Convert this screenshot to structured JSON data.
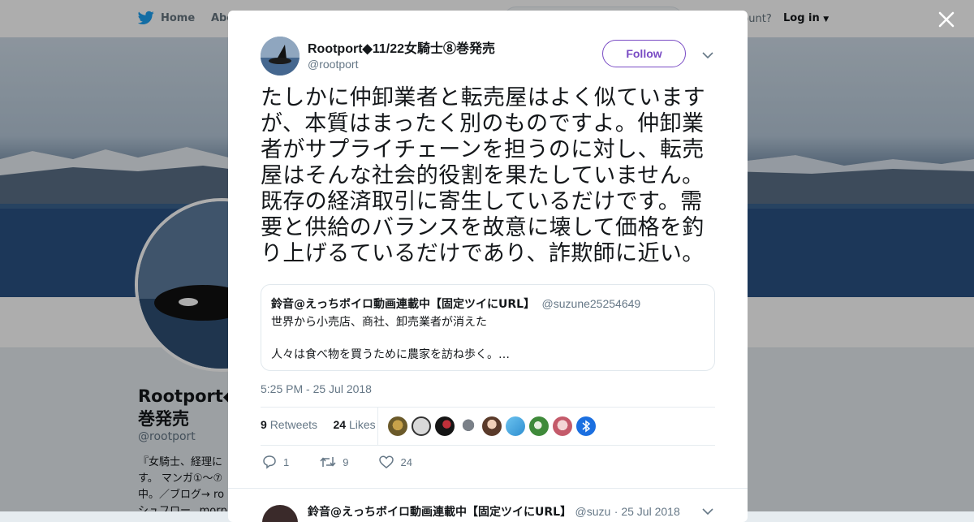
{
  "topbar": {
    "home_label": "Home",
    "about_label": "Abo",
    "account_text": "ccount?",
    "login_label": "Log in"
  },
  "profile": {
    "name": "Rootport◆",
    "name_line2": "巻発売",
    "handle": "@rootport",
    "bio_lines": [
      "『女騎士、経理に",
      "す。 マンガ①～⑦",
      "中。／ブログ→ ro",
      "シュフロー_ morph"
    ]
  },
  "tweet": {
    "author_name": "Rootport◆11/22女騎士⑧巻発売",
    "author_handle": "@rootport",
    "follow_label": "Follow",
    "text": "たしかに仲卸業者と転売屋はよく似ていますが、本質はまったく別のものですよ。仲卸業者がサプライチェーンを担うのに対し、転売屋はそんな社会的役割を果たしていません。既存の経済取引に寄生しているだけです。需要と供給のバランスを故意に壊して価格を釣り上げるているだけであり、詐欺師に近い。",
    "quote": {
      "name": "鈴音@えっちボイロ動画連載中【固定ツイにURL】",
      "handle": "@suzune25254649",
      "line1": "世界から小売店、商社、卸売業者が消えた",
      "line2": "人々は食べ物を買うために農家を訪ね歩く。…"
    },
    "timestamp": "5:25 PM - 25 Jul 2018",
    "retweets_count": "9",
    "retweets_label": "Retweets",
    "likes_count": "24",
    "likes_label": "Likes",
    "likers": [
      "avatar-1",
      "avatar-2",
      "avatar-3",
      "avatar-4",
      "avatar-5",
      "avatar-6",
      "avatar-7",
      "avatar-8",
      "avatar-9"
    ],
    "actions": {
      "reply_count": "1",
      "retweet_count": "9",
      "like_count": "24"
    }
  },
  "reply": {
    "name": "鈴音@えっちボイロ動画連載中【固定ツイにURL】",
    "handle": "@suzu",
    "date": "· 25 Jul 2018"
  },
  "colors": {
    "follow_accent": "#794bc4",
    "twitter_blue": "#1da1f2",
    "text_primary": "#14171a",
    "text_secondary": "#657786"
  }
}
